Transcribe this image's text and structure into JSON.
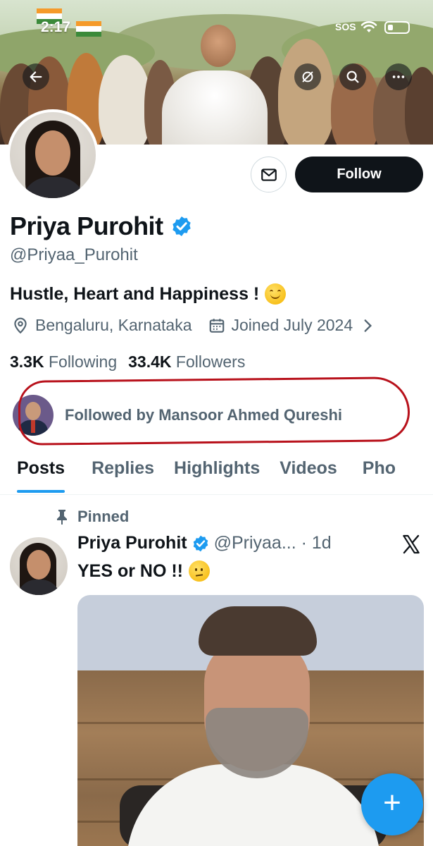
{
  "status_bar": {
    "time": "2:17",
    "sos": "SOS"
  },
  "header": {
    "back_icon": "back-arrow-icon",
    "grok_icon": "grok-icon",
    "search_icon": "search-icon",
    "more_icon": "more-icon"
  },
  "profile": {
    "name": "Priya Purohit",
    "handle": "@Priyaa_Purohit",
    "bio": "Hustle, Heart and Happiness !",
    "location": "Bengaluru, Karnataka",
    "joined": "Joined July 2024",
    "following_count": "3.3K",
    "following_label": "Following",
    "followers_count": "33.4K",
    "followers_label": "Followers",
    "followed_by": "Followed by Mansoor Ahmed Qureshi",
    "follow_button": "Follow",
    "verified_color": "#1d9bf0"
  },
  "tabs": [
    "Posts",
    "Replies",
    "Highlights",
    "Videos",
    "Pho"
  ],
  "active_tab": "Posts",
  "post": {
    "pinned_label": "Pinned",
    "author_name": "Priya Purohit",
    "author_handle": "@Priyaa... · 1d",
    "text": "YES or NO !!"
  },
  "colors": {
    "accent": "#1d9bf0",
    "text": "#0f1419",
    "secondary": "#536471",
    "annotation_ring": "#b8111b"
  }
}
